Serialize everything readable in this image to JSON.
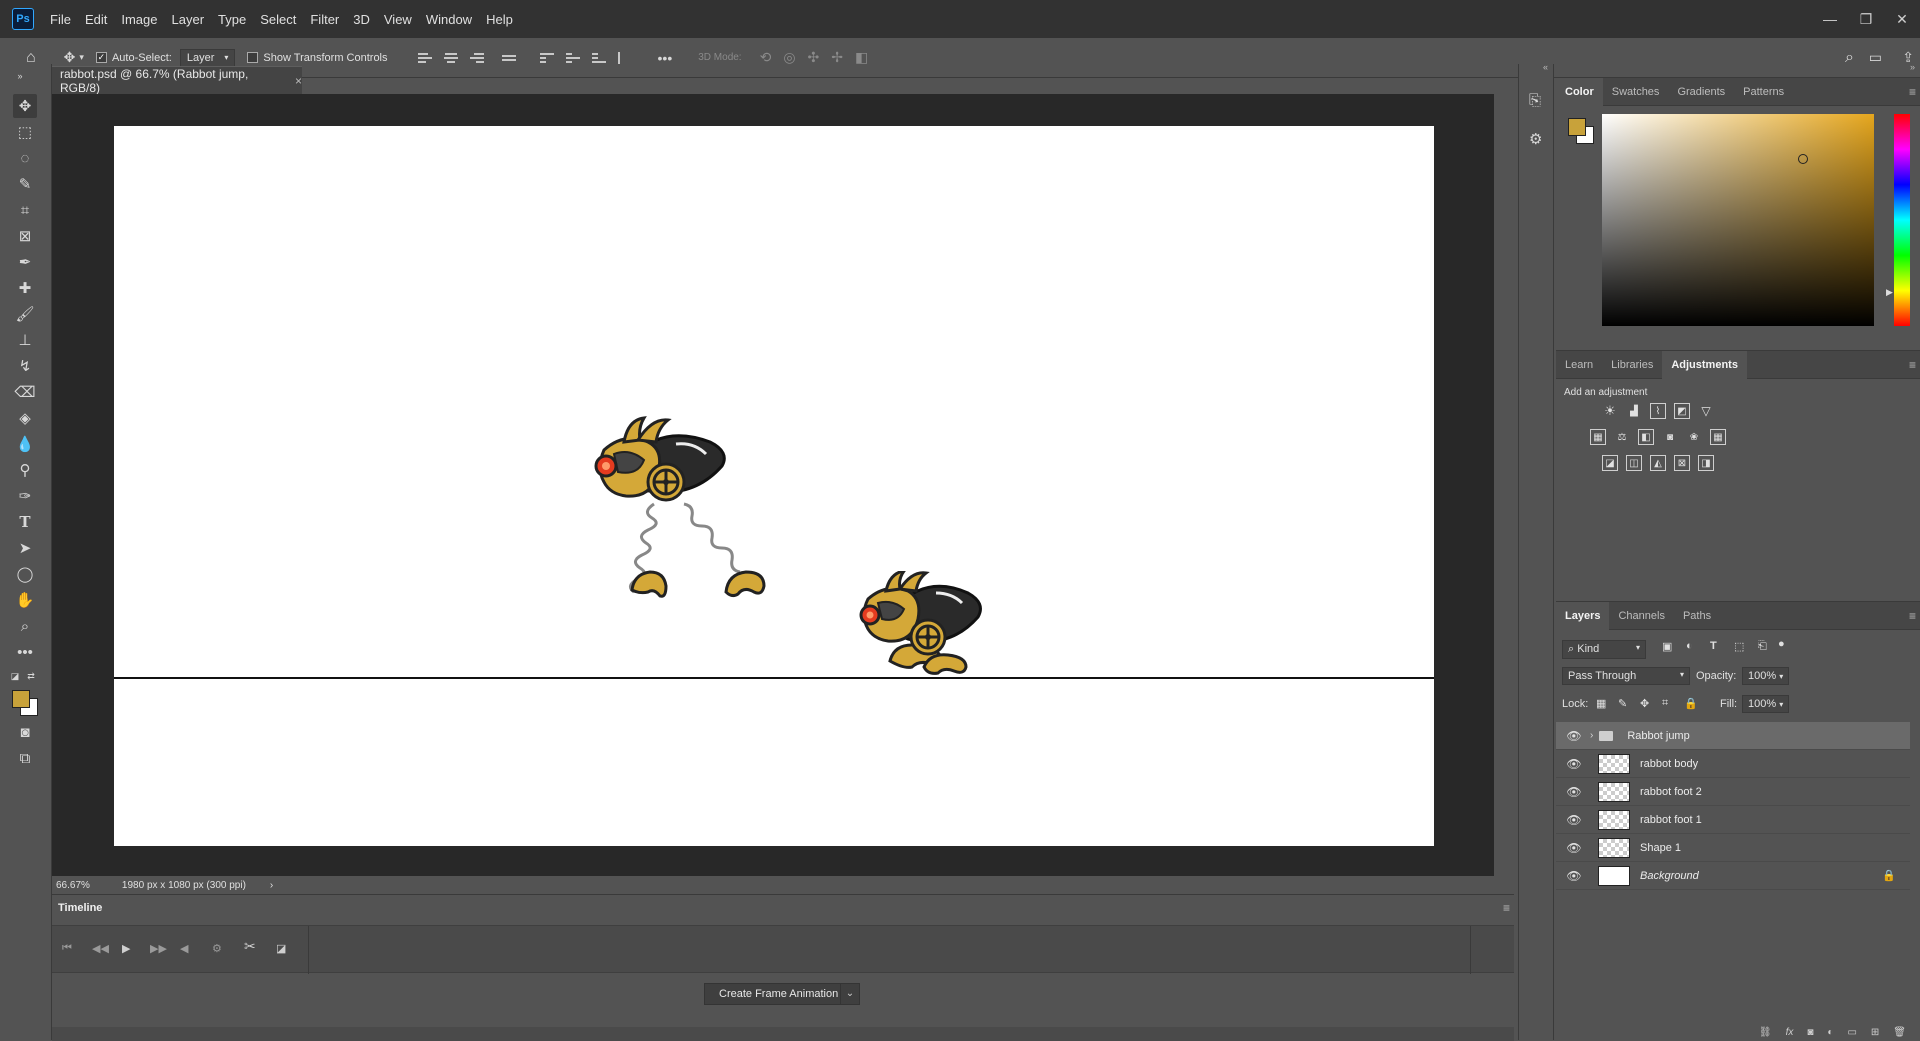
{
  "app": {
    "logo": "Ps"
  },
  "menu": [
    "File",
    "Edit",
    "Image",
    "Layer",
    "Type",
    "Select",
    "Filter",
    "3D",
    "View",
    "Window",
    "Help"
  ],
  "options": {
    "auto_select_label": "Auto-Select:",
    "auto_select_target": "Layer",
    "show_transform_label": "Show Transform Controls",
    "mode_3d_label": "3D Mode:"
  },
  "document": {
    "tab_title": "rabbot.psd @ 66.7% (Rabbot jump, RGB/8)",
    "zoom": "66.67%",
    "dimensions": "1980 px x 1080 px (300 ppi)"
  },
  "timeline": {
    "title": "Timeline",
    "create_button": "Create Frame Animation"
  },
  "color_panel": {
    "tabs": [
      "Color",
      "Swatches",
      "Gradients",
      "Patterns"
    ],
    "active_tab": "Color",
    "foreground_color": "#c8a23a",
    "background_color": "#ffffff"
  },
  "adjustments_panel": {
    "tabs": [
      "Learn",
      "Libraries",
      "Adjustments"
    ],
    "active_tab": "Adjustments",
    "heading": "Add an adjustment"
  },
  "layers_panel": {
    "tabs": [
      "Layers",
      "Channels",
      "Paths"
    ],
    "active_tab": "Layers",
    "filter_kind": "Kind",
    "blend_mode": "Pass Through",
    "opacity_label": "Opacity:",
    "opacity": "100%",
    "lock_label": "Lock:",
    "fill_label": "Fill:",
    "fill": "100%",
    "layers": [
      {
        "name": "Rabbot jump",
        "type": "group"
      },
      {
        "name": "rabbot body",
        "type": "layer"
      },
      {
        "name": "rabbot foot 2",
        "type": "layer"
      },
      {
        "name": "rabbot foot 1",
        "type": "layer"
      },
      {
        "name": "Shape 1",
        "type": "shape"
      },
      {
        "name": "Background",
        "type": "background"
      }
    ]
  },
  "colors": {
    "rabbot_gold": "#d4a838",
    "rabbot_dark": "#2a2a2a",
    "eye_red": "#e53b1f"
  }
}
